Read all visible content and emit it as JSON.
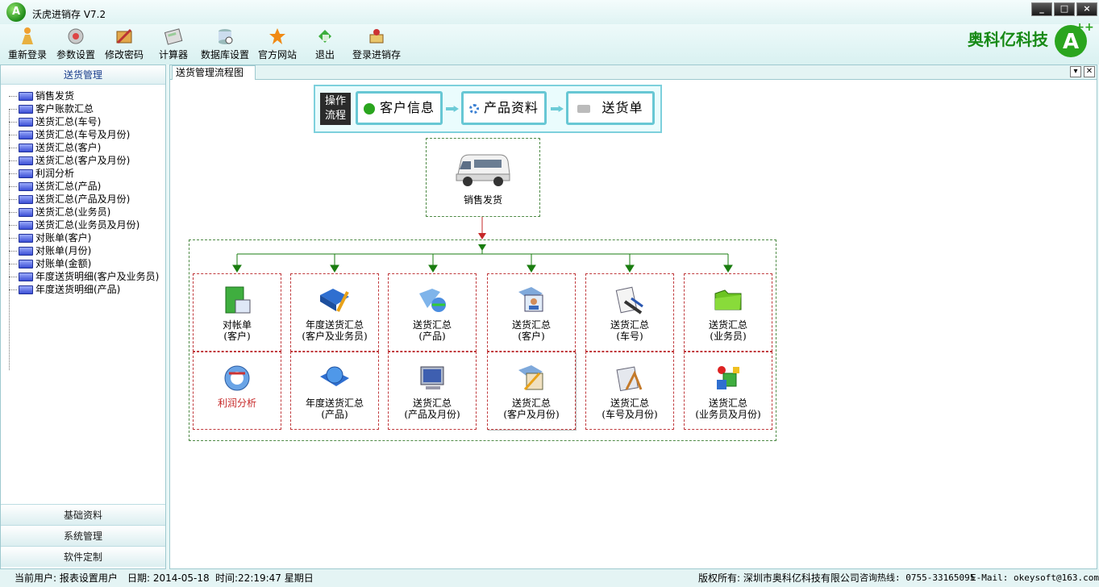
{
  "window": {
    "title": "沃虎进销存 V7.2",
    "controls": [
      "_",
      "□",
      "×"
    ]
  },
  "toolbar": {
    "items": [
      {
        "label": "重新登录",
        "icon": "person-icon"
      },
      {
        "label": "参数设置",
        "icon": "settings-icon"
      },
      {
        "label": "修改密码",
        "icon": "password-icon"
      },
      {
        "label": "计算器",
        "icon": "calculator-icon"
      },
      {
        "label": "数据库设置",
        "icon": "database-icon"
      },
      {
        "label": "官方网站",
        "icon": "star-icon"
      },
      {
        "label": "退出",
        "icon": "exit-icon"
      },
      {
        "label": "登录进销存",
        "icon": "login-icon"
      }
    ],
    "brand": "奥科亿科技"
  },
  "sidebar": {
    "header": "送货管理",
    "items": [
      "销售发货",
      "客户账款汇总",
      "送货汇总(车号)",
      "送货汇总(车号及月份)",
      "送货汇总(客户)",
      "送货汇总(客户及月份)",
      "利润分析",
      "送货汇总(产品)",
      "送货汇总(产品及月份)",
      "送货汇总(业务员)",
      "送货汇总(业务员及月份)",
      "对账单(客户)",
      "对账单(月份)",
      "对账单(金额)",
      "年度送货明细(客户及业务员)",
      "年度送货明细(产品)"
    ],
    "sections": [
      "基础资料",
      "系统管理",
      "软件定制"
    ]
  },
  "main": {
    "tab": "送货管理流程图",
    "flow": {
      "label": "操作流程",
      "steps": [
        "客户信息",
        "产品资料",
        "送货单"
      ]
    },
    "source_node": "销售发货",
    "nodes_top": [
      {
        "l1": "对帐单",
        "l2": "(客户)"
      },
      {
        "l1": "年度送货汇总",
        "l2": "(客户及业务员)"
      },
      {
        "l1": "送货汇总",
        "l2": "(产品)"
      },
      {
        "l1": "送货汇总",
        "l2": "(客户)"
      },
      {
        "l1": "送货汇总",
        "l2": "(车号)"
      },
      {
        "l1": "送货汇总",
        "l2": "(业务员)"
      }
    ],
    "nodes_bottom": [
      {
        "l1": "利润分析",
        "l2": ""
      },
      {
        "l1": "年度送货汇总",
        "l2": "(产品)"
      },
      {
        "l1": "送货汇总",
        "l2": "(产品及月份)"
      },
      {
        "l1": "送货汇总",
        "l2": "(客户及月份)"
      },
      {
        "l1": "送货汇总",
        "l2": "(车号及月份)"
      },
      {
        "l1": "送货汇总",
        "l2": "(业务员及月份)"
      }
    ]
  },
  "statusbar": {
    "user": "当前用户: 报表设置用户",
    "date": "日期: 2014-05-18",
    "time": "时间:22:19:47 星期日",
    "copyright": "版权所有: 深圳市奥科亿科技有限公司",
    "hotline": "咨询热线: 0755-33165095",
    "email": "E-Mail: okeysoft@163.com"
  },
  "colors": {
    "accent": "#67c7d4",
    "brand": "#178a16",
    "flow_line": "#1a7d10",
    "node_border": "#c0393c"
  }
}
